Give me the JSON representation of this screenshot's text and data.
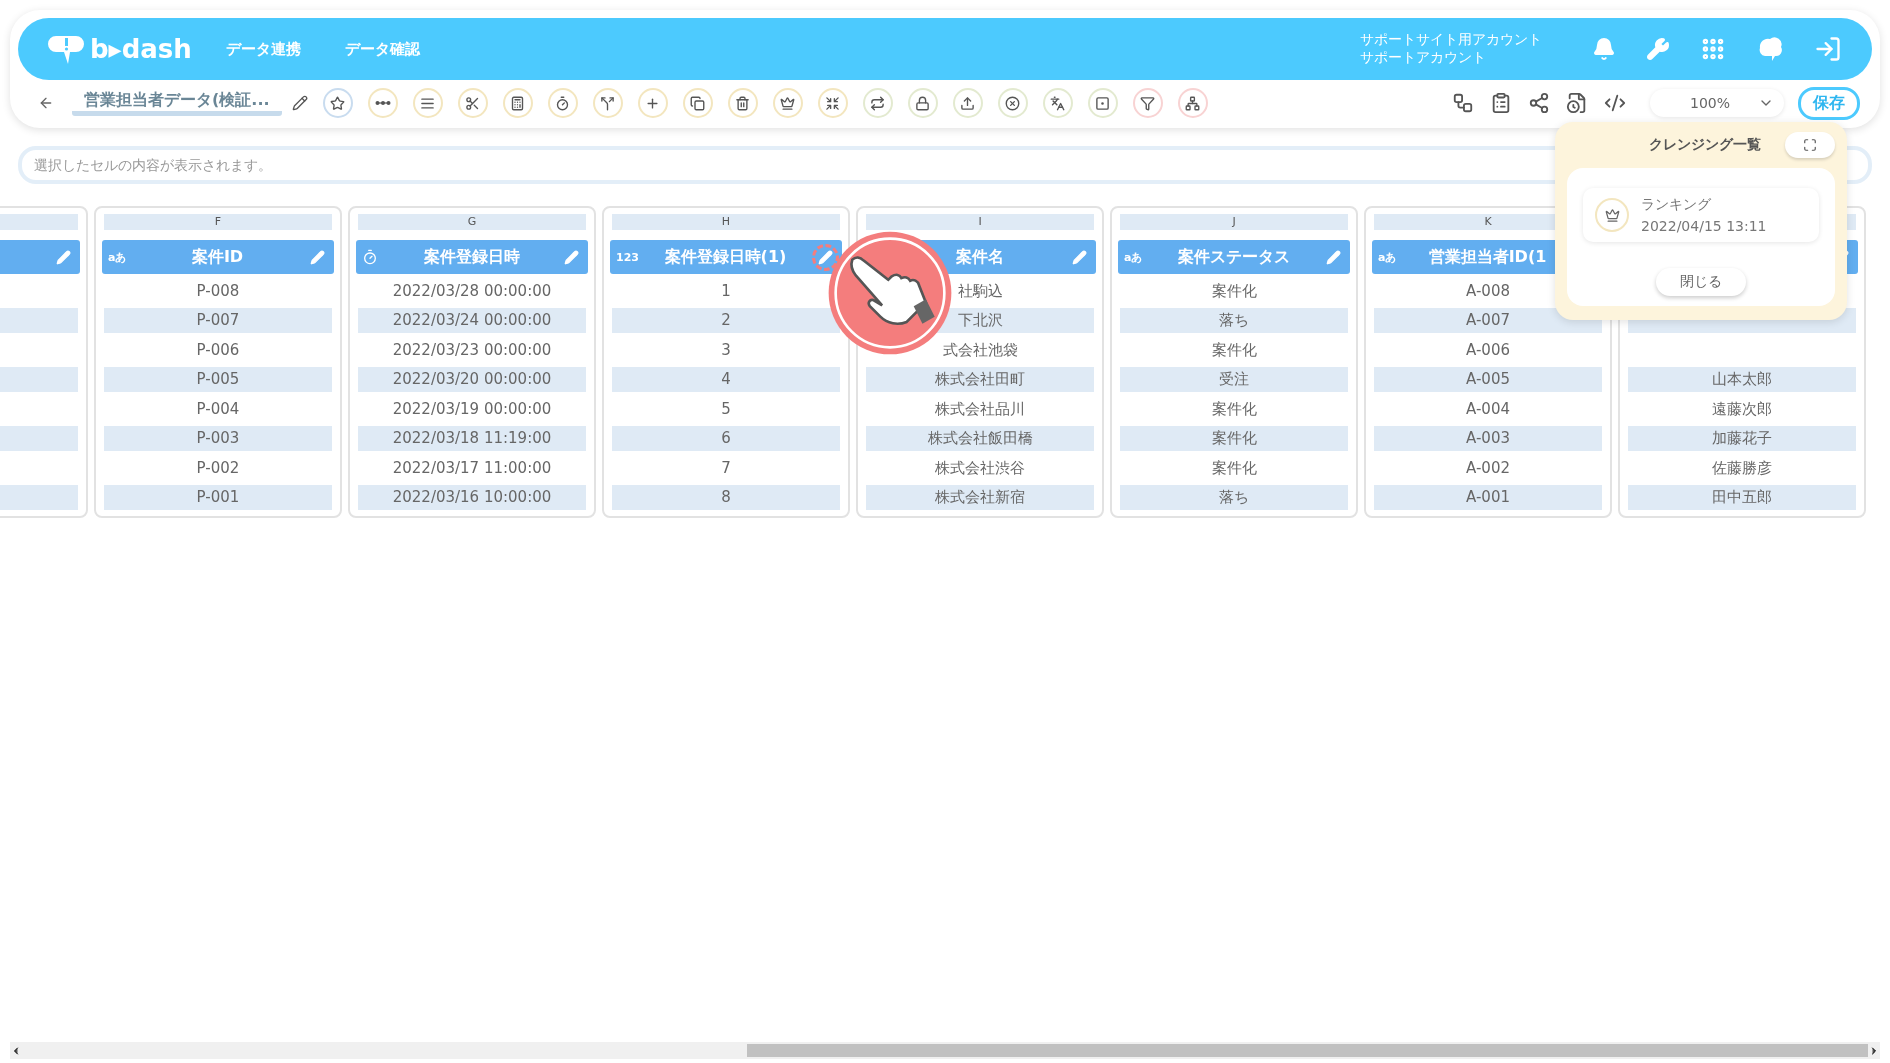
{
  "header": {
    "logo": "b▸dash",
    "nav": [
      {
        "label": "データ連携"
      },
      {
        "label": "データ確認"
      }
    ],
    "account": [
      "サポートサイト用アカウント",
      "サポートアカウント"
    ]
  },
  "toolbar": {
    "title": "営業担当者データ(検証...",
    "tools": [
      {
        "color": "#c9dcef"
      },
      {
        "color": "#f3e6bf"
      },
      {
        "color": "#f3e6bf"
      },
      {
        "color": "#f3e6bf"
      },
      {
        "color": "#f3e6bf"
      },
      {
        "color": "#f3e6bf"
      },
      {
        "color": "#f3e6bf"
      },
      {
        "color": "#f3e6bf"
      },
      {
        "color": "#f3e6bf"
      },
      {
        "color": "#f3e6bf"
      },
      {
        "color": "#f3e6bf"
      },
      {
        "color": "#f3e6bf"
      },
      {
        "color": "#e3ead0"
      },
      {
        "color": "#e3ead0"
      },
      {
        "color": "#e3ead0"
      },
      {
        "color": "#e3ead0"
      },
      {
        "color": "#e3ead0"
      },
      {
        "color": "#e3ead0"
      },
      {
        "color": "#f8d3d3"
      },
      {
        "color": "#f8d3d3"
      }
    ],
    "zoom": "100%",
    "save": "保存"
  },
  "formula_bar": {
    "placeholder": "選択したセルの内容が表示されます。"
  },
  "columns": [
    {
      "kind": "plain",
      "highlighted": false
    },
    {
      "letter": "F",
      "kind": "text",
      "type_mark": "aあ",
      "name": "案件ID",
      "highlighted": false,
      "cells": [
        "P-008",
        "P-007",
        "P-006",
        "P-005",
        "P-004",
        "P-003",
        "P-002",
        "P-001"
      ]
    },
    {
      "letter": "G",
      "kind": "date",
      "name": "案件登録日時",
      "highlighted": false,
      "cells": [
        "2022/03/28 00:00:00",
        "2022/03/24 00:00:00",
        "2022/03/23 00:00:00",
        "2022/03/20 00:00:00",
        "2022/03/19 00:00:00",
        "2022/03/18 11:19:00",
        "2022/03/17 11:00:00",
        "2022/03/16 10:00:00"
      ]
    },
    {
      "letter": "H",
      "kind": "number",
      "type_mark": "123",
      "name": "案件登録日時(1)",
      "highlighted": true,
      "cells": [
        "1",
        "2",
        "3",
        "4",
        "5",
        "6",
        "7",
        "8"
      ]
    },
    {
      "letter": "I",
      "kind": "plain",
      "name": "案件名",
      "highlighted": false,
      "cells": [
        "社駒込",
        "下北沢",
        "式会社池袋",
        "株式会社田町",
        "株式会社品川",
        "株式会社飯田橋",
        "株式会社渋谷",
        "株式会社新宿"
      ]
    },
    {
      "letter": "J",
      "kind": "text",
      "type_mark": "aあ",
      "name": "案件ステータス",
      "highlighted": false,
      "cells": [
        "案件化",
        "落ち",
        "案件化",
        "受注",
        "案件化",
        "案件化",
        "案件化",
        "落ち"
      ]
    },
    {
      "letter": "K",
      "kind": "text",
      "type_mark": "aあ",
      "name": "営業担当者ID(1",
      "cells": [
        "A-008",
        "A-007",
        "A-006",
        "A-005",
        "A-004",
        "A-003",
        "A-002",
        "A-001"
      ]
    },
    {
      "kind": "plain",
      "cells": [
        "山本太郎",
        "遠藤次郎",
        "加藤花子",
        "佐藤勝彦",
        "田中五郎"
      ]
    }
  ],
  "panel": {
    "title": "クレンジング一覧",
    "items": [
      {
        "name": "ランキング",
        "date": "2022/04/15 13:11"
      }
    ],
    "close": "閉じる"
  }
}
